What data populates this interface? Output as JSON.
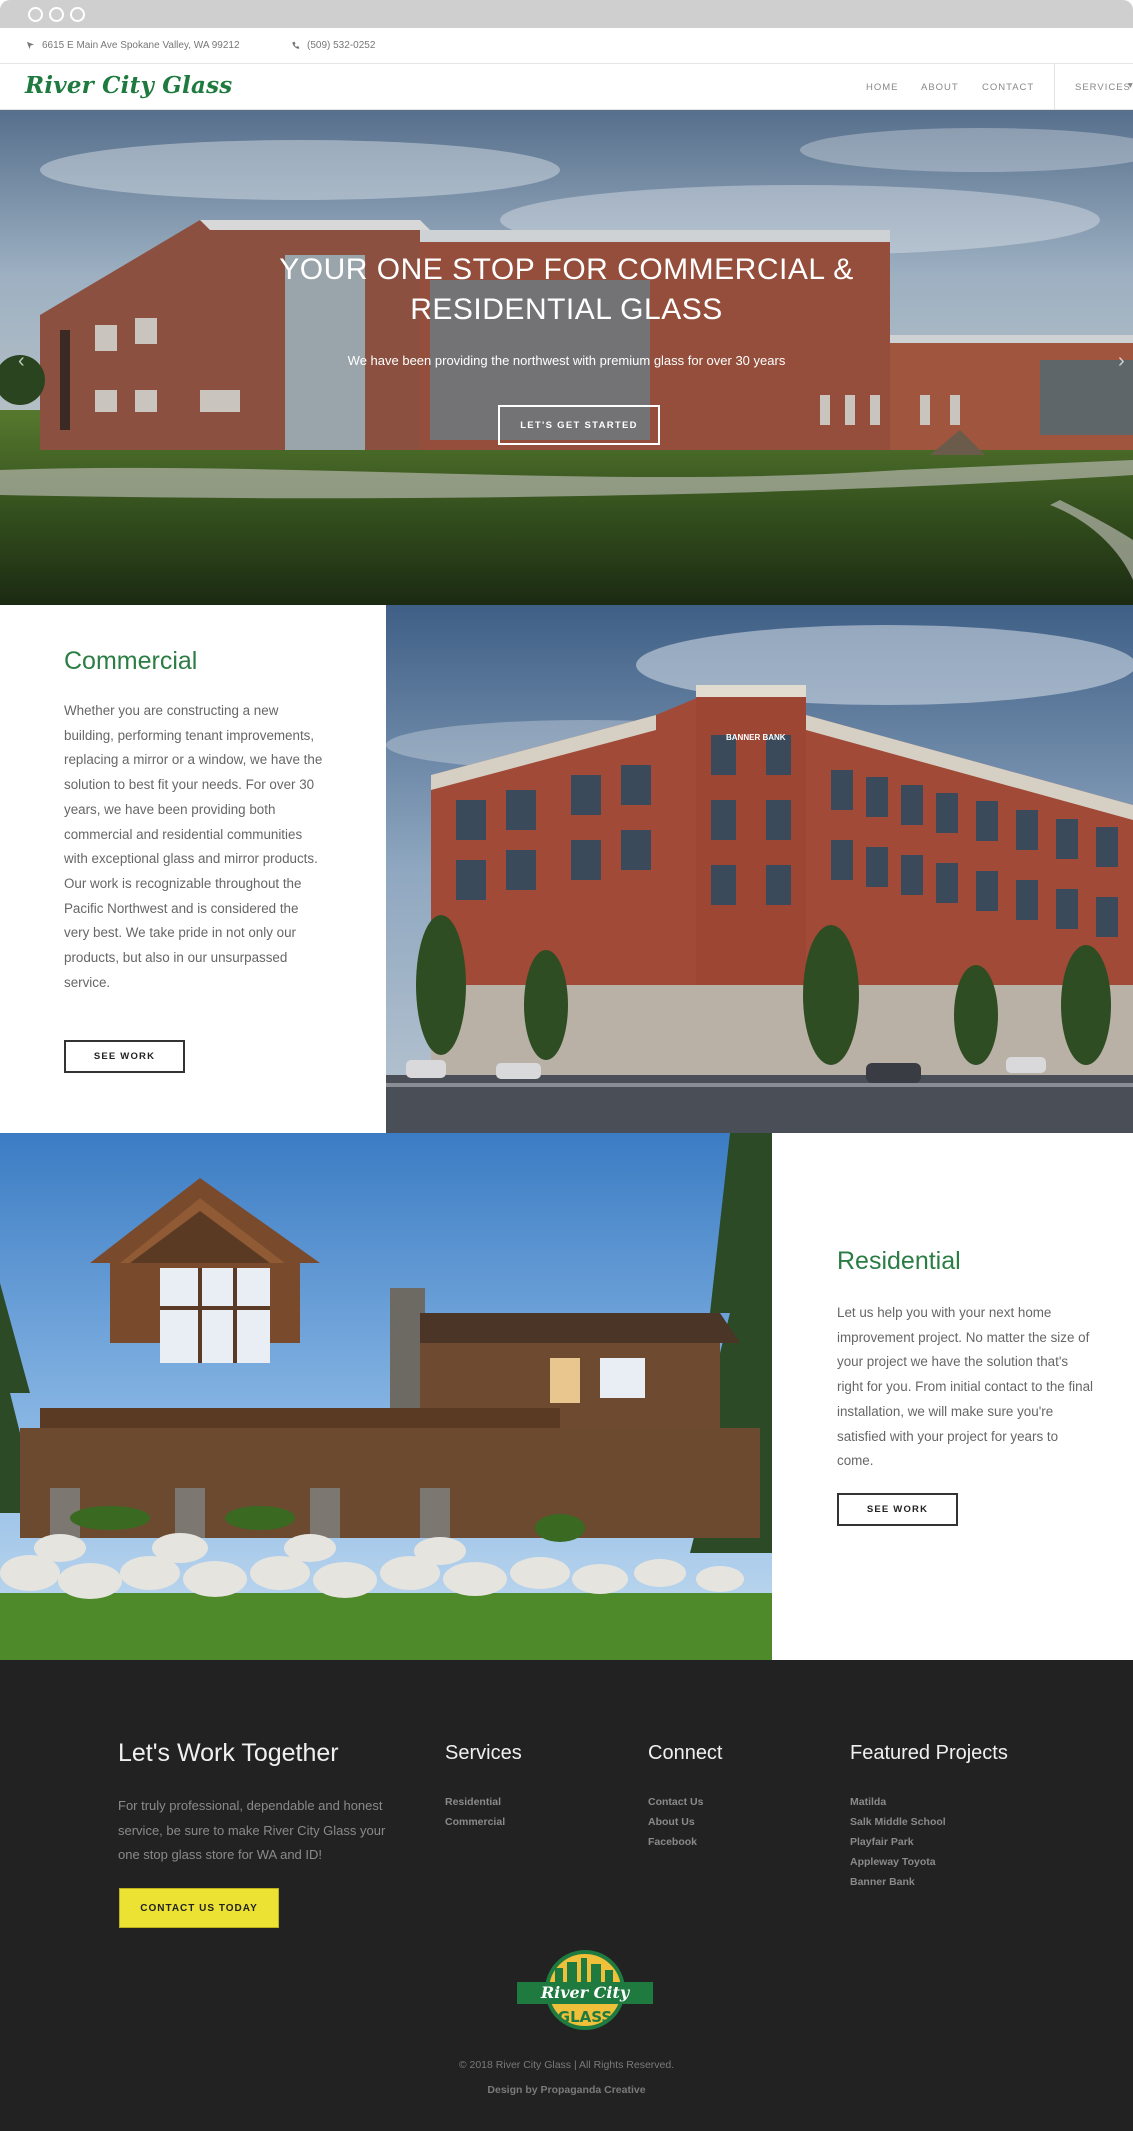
{
  "topbar": {
    "address": "6615 E Main Ave Spokane Valley, WA 99212",
    "phone": "(509) 532-0252"
  },
  "header": {
    "logo": "River City Glass",
    "nav": [
      {
        "label": "HOME"
      },
      {
        "label": "ABOUT"
      },
      {
        "label": "CONTACT"
      },
      {
        "label": "SERVICES"
      }
    ]
  },
  "hero": {
    "title_line1": "YOUR ONE STOP FOR COMMERCIAL &",
    "title_line2": "RESIDENTIAL GLASS",
    "subtitle": "We have been providing the northwest with premium glass for over 30 years",
    "button": "LET'S GET STARTED"
  },
  "commercial": {
    "title": "Commercial",
    "body": "Whether you are constructing a new building, performing tenant improvements, replacing a mirror or a window, we have the solution to best fit your needs. For over 30 years, we have been providing both commercial and residential communities with exceptional glass and mirror products. Our work is recognizable throughout the Pacific Northwest and is considered the very best. We take pride in not only our products, but also in our unsurpassed service.",
    "button": "SEE WORK",
    "image_sign": "BANNER BANK"
  },
  "residential": {
    "title": "Residential",
    "body": "Let us help you with your next home improvement project. No matter the size of your project we have the solution that's right for you. From initial contact to the final installation, we will make sure you're satisfied with your project for years to come.",
    "button": "SEE WORK"
  },
  "footer": {
    "cta_title": "Let's Work Together",
    "cta_body": "For truly professional, dependable and honest service, be sure to make River City Glass your one stop glass store for WA and ID!",
    "cta_button": "CONTACT US TODAY",
    "services": {
      "title": "Services",
      "links": [
        "Residential",
        "Commercial"
      ]
    },
    "connect": {
      "title": "Connect",
      "links": [
        "Contact Us",
        "About Us",
        "Facebook"
      ]
    },
    "projects": {
      "title": "Featured Projects",
      "links": [
        "Matilda",
        "Salk Middle School",
        "Playfair Park",
        "Appleway Toyota",
        "Banner Bank"
      ]
    },
    "logo_line1": "River City",
    "logo_line2": "GLASS",
    "copyright": "© 2018 River City Glass | All Rights Reserved.",
    "credit": "Design by Propaganda Creative"
  },
  "colors": {
    "brand_green": "#2c7d45",
    "cta_yellow": "#ece233",
    "footer_bg": "#222222"
  }
}
